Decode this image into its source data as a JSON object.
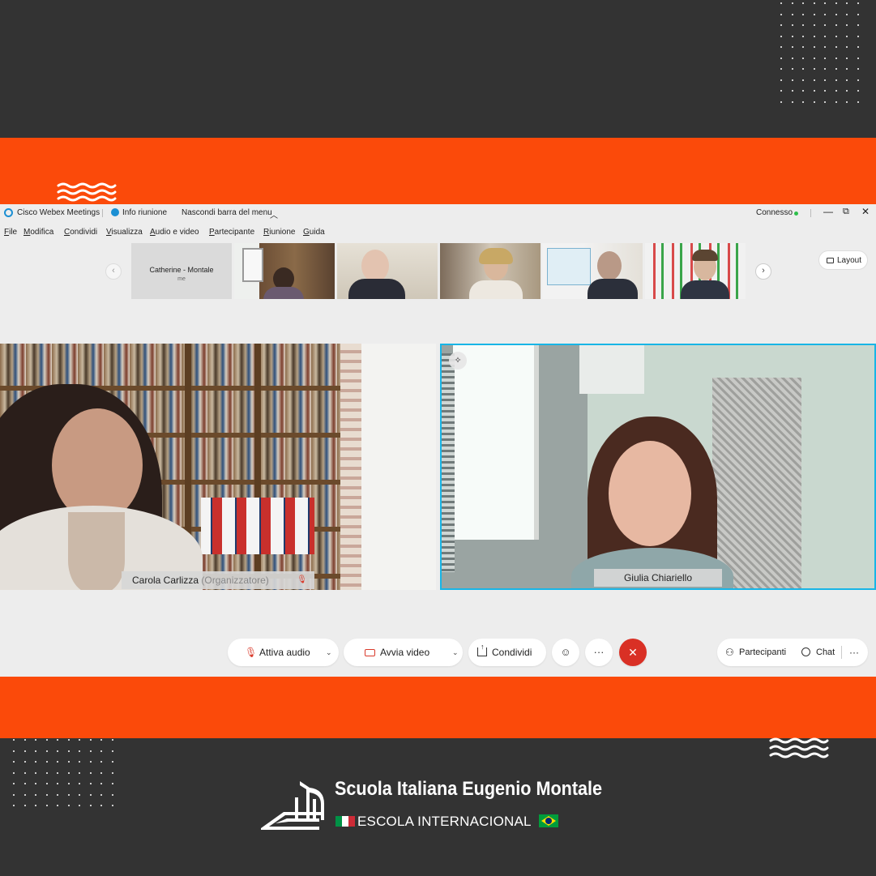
{
  "app": {
    "title": "Cisco Webex Meetings",
    "info_label": "Info riunione",
    "hide_menu_label": "Nascondi barra del menu",
    "status": "Connesso",
    "status_color": "#2fbf4b"
  },
  "menu": [
    "File",
    "Modifica",
    "Condividi",
    "Visualizza",
    "Audio e video",
    "Partecipante",
    "Riunione",
    "Guida"
  ],
  "filmstrip": {
    "self_name": "Catherine - Montale",
    "self_sub": "me",
    "layout_label": "Layout"
  },
  "participants": {
    "left": {
      "name": "Carola Carlizza",
      "role": "(Organizzatore)"
    },
    "right": {
      "name": "Giulia Chiariello"
    }
  },
  "controls": {
    "audio": "Attiva audio",
    "video": "Avvia video",
    "share": "Condividi",
    "participants": "Partecipanti",
    "chat": "Chat"
  },
  "branding": {
    "school_name": "Scuola Italiana Eugenio Montale",
    "subtitle": "ESCOLA INTERNACIONAL",
    "accent": "#fb4a0a",
    "background": "#333333"
  }
}
